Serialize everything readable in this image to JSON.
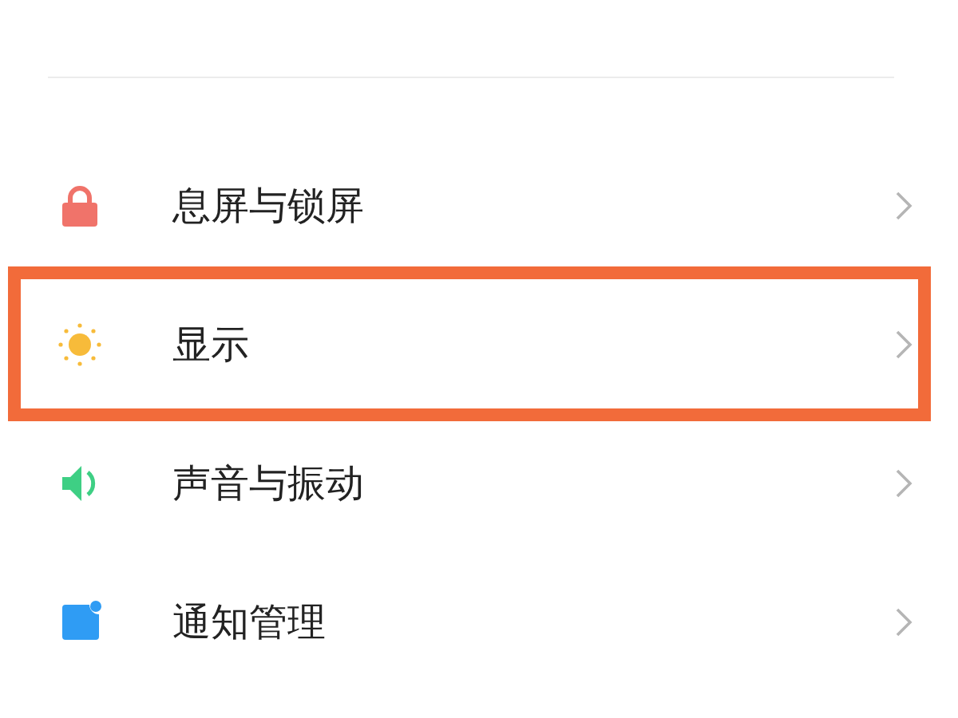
{
  "settings": [
    {
      "label": "息屏与锁屏",
      "highlighted": false
    },
    {
      "label": "显示",
      "highlighted": true
    },
    {
      "label": "声音与振动",
      "highlighted": false
    },
    {
      "label": "通知管理",
      "highlighted": false
    }
  ]
}
